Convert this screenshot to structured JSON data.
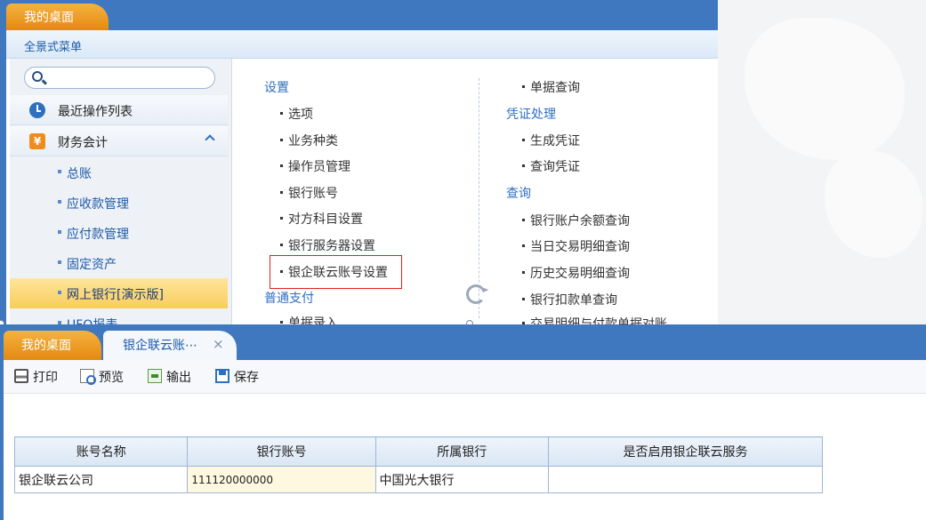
{
  "top_window": {
    "tab_label": "我的桌面",
    "menu_title": "全景式菜单",
    "search": {
      "placeholder": "",
      "value": ""
    },
    "sidebar": {
      "sections": [
        {
          "label": "最近操作列表",
          "icon": "clock-icon"
        },
        {
          "label": "财务会计",
          "icon": "yen-icon",
          "expanded": true
        }
      ],
      "items": [
        {
          "label": "总账"
        },
        {
          "label": "应收款管理"
        },
        {
          "label": "应付款管理"
        },
        {
          "label": "固定资产"
        },
        {
          "label": "网上银行[演示版]",
          "active": true
        },
        {
          "label": "UFO报表"
        }
      ]
    },
    "menu": {
      "col1": {
        "groups": [
          {
            "heading": "设置",
            "links": [
              "选项",
              "业务种类",
              "操作员管理",
              "银行账号",
              "对方科目设置",
              "银行服务器设置",
              "银企联云账号设置"
            ]
          },
          {
            "heading": "普通支付",
            "links": [
              "单据录入"
            ]
          }
        ]
      },
      "col2": {
        "top_link": "单据查询",
        "groups": [
          {
            "heading": "凭证处理",
            "links": [
              "生成凭证",
              "查询凭证"
            ]
          },
          {
            "heading": "查询",
            "links": [
              "银行账户余额查询",
              "当日交易明细查询",
              "历史交易明细查询",
              "银行扣款单查询",
              "交易明细与付款单据对账"
            ]
          }
        ]
      }
    }
  },
  "bottom_window": {
    "tabs": {
      "home": "我的桌面",
      "active": "银企联云账⋯",
      "close": "×"
    },
    "toolbar": {
      "print": "打印",
      "preview": "预览",
      "export": "输出",
      "save": "保存"
    },
    "table": {
      "columns": [
        "账号名称",
        "银行账号",
        "所属银行",
        "是否启用银企联云服务"
      ],
      "rows": [
        [
          "银企联云公司",
          "111120000000",
          "中国光大银行",
          ""
        ]
      ]
    }
  },
  "colors": {
    "header_blue": "#3f78bf",
    "tab_orange": "#e38a12",
    "link_blue": "#2e6fc0",
    "highlight_red": "#e02020"
  }
}
